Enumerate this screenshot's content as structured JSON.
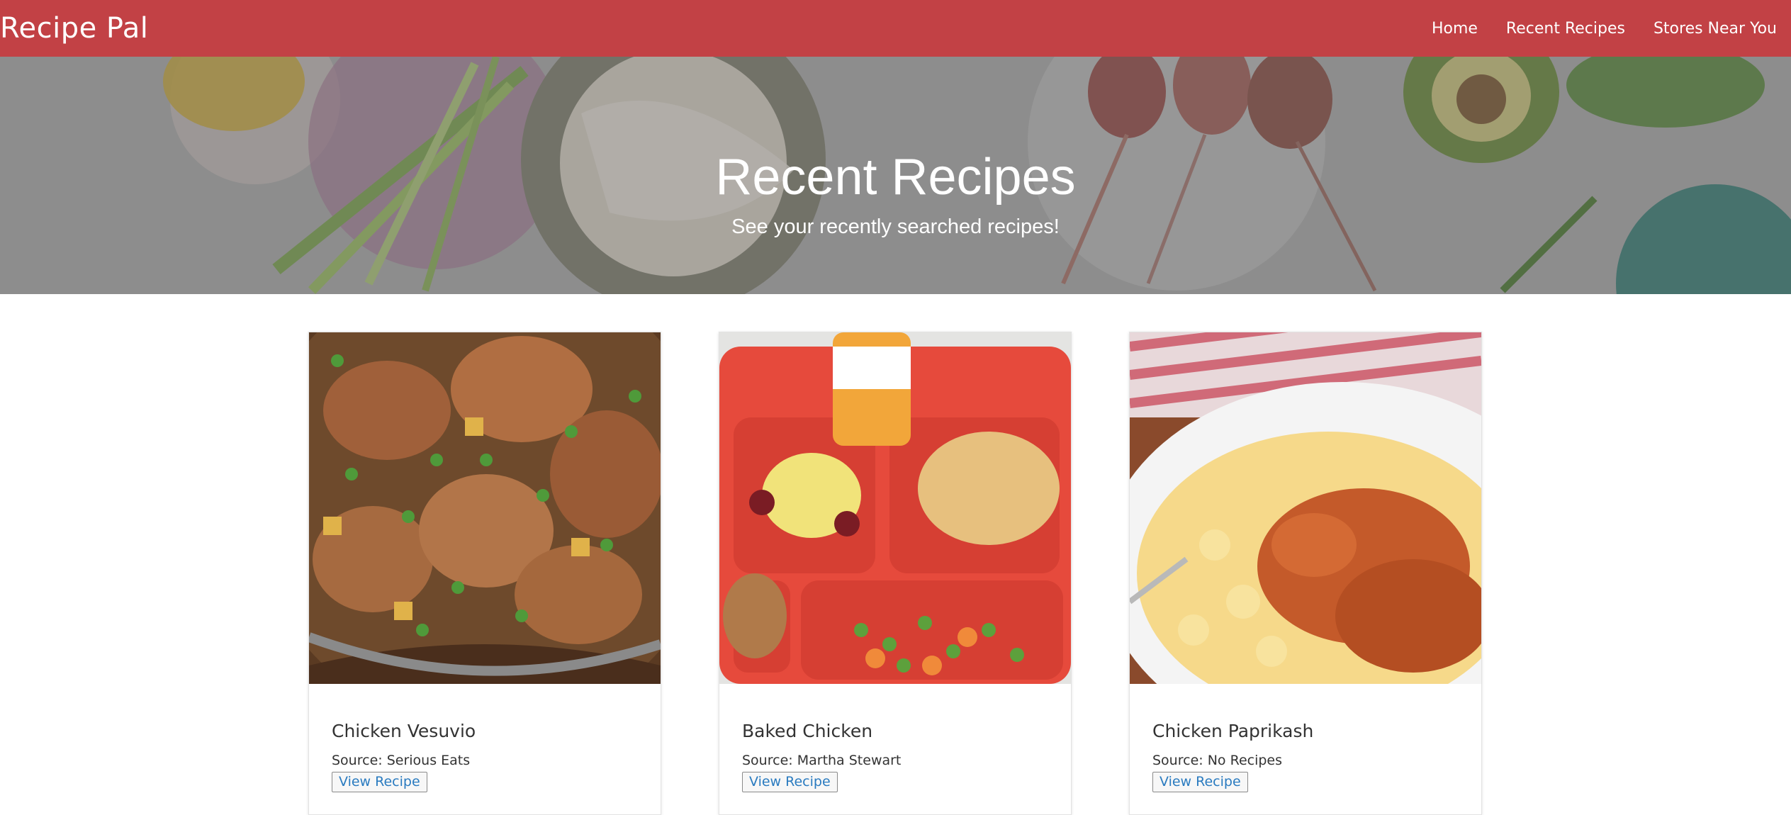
{
  "navbar": {
    "brand": "Recipe Pal",
    "links": [
      "Home",
      "Recent Recipes",
      "Stores Near You"
    ],
    "background_color": "#c24145"
  },
  "hero": {
    "title": "Recent Recipes",
    "subtitle": "See your recently searched recipes!"
  },
  "recipes": [
    {
      "title": "Chicken Vesuvio",
      "source_label": "Source:",
      "source": "Serious Eats",
      "button": "View Recipe"
    },
    {
      "title": "Baked Chicken",
      "source_label": "Source:",
      "source": "Martha Stewart",
      "button": "View Recipe"
    },
    {
      "title": "Chicken Paprikash",
      "source_label": "Source:",
      "source": "No Recipes",
      "button": "View Recipe"
    }
  ]
}
